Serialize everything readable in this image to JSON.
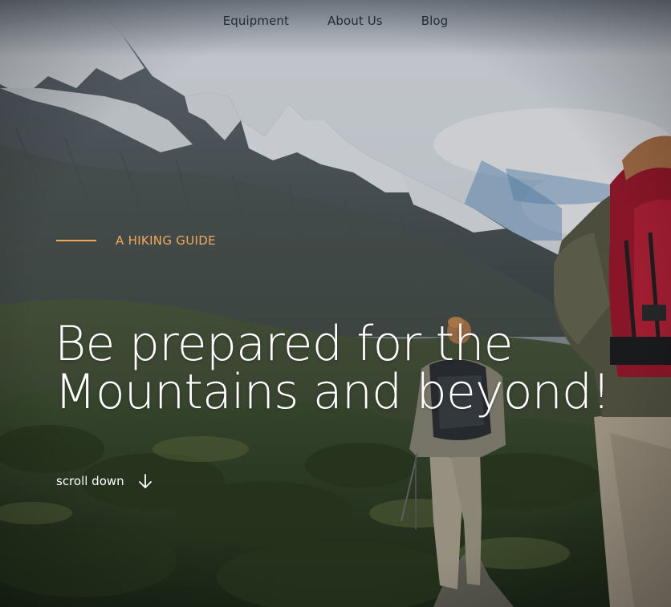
{
  "nav": {
    "items": [
      {
        "label": "Equipment"
      },
      {
        "label": "About Us"
      },
      {
        "label": "Blog"
      }
    ]
  },
  "hero": {
    "eyebrow": "A HIKING GUIDE",
    "headline_line1": "Be prepared for the",
    "headline_line2": "Mountains and beyond!",
    "scroll_label": "scroll down"
  },
  "colors": {
    "accent": "#f4a85c",
    "headline": "#ffffff",
    "nav_text": "#1f2b33"
  },
  "icons": {
    "scroll": "arrow-down-icon"
  }
}
